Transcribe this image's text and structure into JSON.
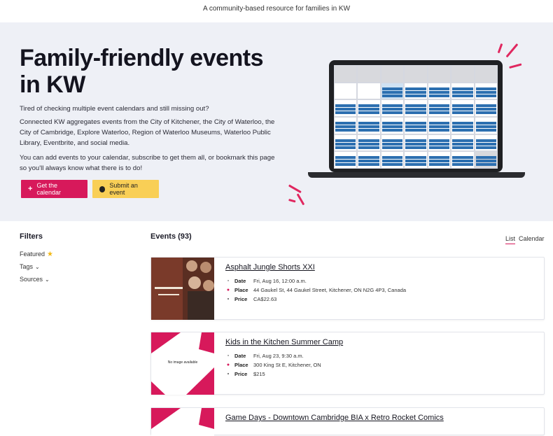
{
  "tagline": "A community-based resource for families in KW",
  "hero": {
    "title": "Family-friendly events in KW",
    "p1": "Tired of checking multiple event calendars and still missing out?",
    "p2": "Connected KW aggregates events from the City of Kitchener, the City of Waterloo, the City of Cambridge, Explore Waterloo, Region of Waterloo Museums, Waterloo Public Library, Eventbrite, and social media.",
    "p3": "You can add events to your calendar, subscribe to get them all, or bookmark this page so you'll always know what there is to do!",
    "btn_calendar": "Get the calendar",
    "btn_submit": "Submit an event"
  },
  "colors": {
    "accent": "#d7195b",
    "yellow": "#f9cf56",
    "hero_bg": "#eef0f6",
    "cal_event": "#2c6fb0"
  },
  "filters": {
    "title": "Filters",
    "featured": "Featured",
    "tags": "Tags",
    "sources": "Sources"
  },
  "events": {
    "heading": "Events (93)",
    "view_list": "List",
    "view_calendar": "Calendar",
    "labels": {
      "date": "Date",
      "place": "Place",
      "price": "Price"
    },
    "items": [
      {
        "title": "Asphalt Jungle Shorts XXI",
        "date": "Fri, Aug 16, 12:00 a.m.",
        "place": "44 Gaukel St, 44 Gaukel Street, Kitchener, ON N2G 4P3, Canada",
        "price": "CA$22.63"
      },
      {
        "title": "Kids in the Kitchen Summer Camp",
        "date": "Fri, Aug 23, 9:30 a.m.",
        "place": "300 King St E, Kitchener, ON",
        "price": "$215",
        "thumb_text": "No image available"
      },
      {
        "title": "Game Days - Downtown Cambridge BIA x Retro Rocket Comics"
      }
    ]
  }
}
